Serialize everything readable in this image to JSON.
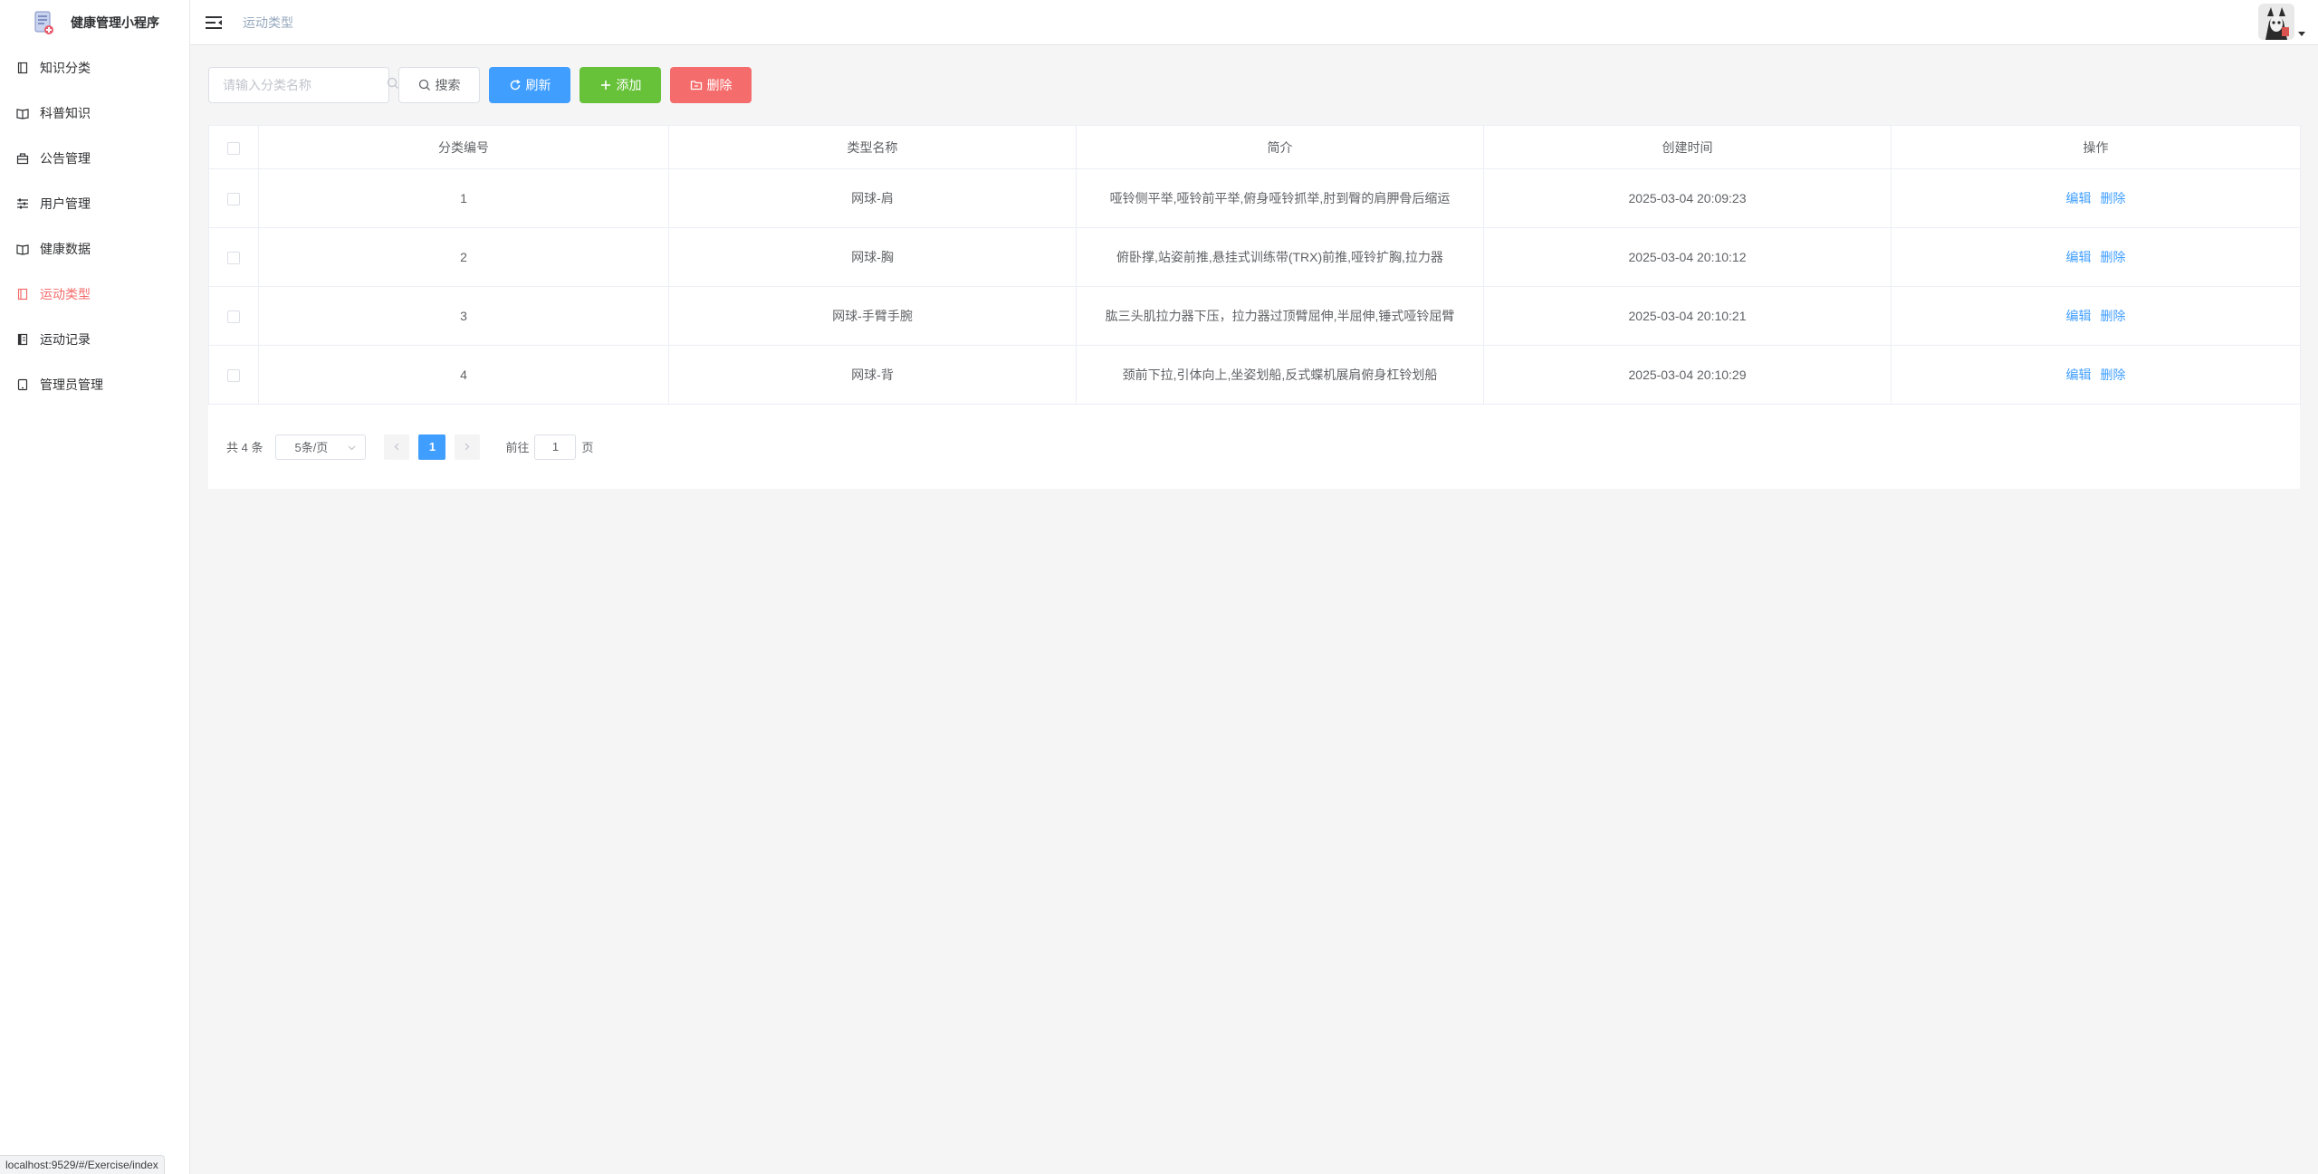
{
  "app": {
    "title": "健康管理小程序"
  },
  "sidebar": {
    "items": [
      {
        "label": "知识分类",
        "icon": "book-icon",
        "active": false
      },
      {
        "label": "科普知识",
        "icon": "open-book-icon",
        "active": false
      },
      {
        "label": "公告管理",
        "icon": "briefcase-icon",
        "active": false
      },
      {
        "label": "用户管理",
        "icon": "sliders-icon",
        "active": false
      },
      {
        "label": "健康数据",
        "icon": "open-book-icon",
        "active": false
      },
      {
        "label": "运动类型",
        "icon": "book-icon",
        "active": true
      },
      {
        "label": "运动记录",
        "icon": "notebook-icon",
        "active": false
      },
      {
        "label": "管理员管理",
        "icon": "tablet-icon",
        "active": false
      }
    ]
  },
  "header": {
    "breadcrumb": "运动类型"
  },
  "toolbar": {
    "search_placeholder": "请输入分类名称",
    "search_label": "搜索",
    "refresh_label": "刷新",
    "add_label": "添加",
    "delete_label": "删除"
  },
  "table": {
    "columns": [
      "分类编号",
      "类型名称",
      "简介",
      "创建时间",
      "操作"
    ],
    "rows": [
      {
        "id": "1",
        "name": "网球-肩",
        "desc": "哑铃侧平举,哑铃前平举,俯身哑铃抓举,肘到臀的肩胛骨后缩运",
        "created": "2025-03-04 20:09:23"
      },
      {
        "id": "2",
        "name": "网球-胸",
        "desc": "俯卧撑,站姿前推,悬挂式训练带(TRX)前推,哑铃扩胸,拉力器",
        "created": "2025-03-04 20:10:12"
      },
      {
        "id": "3",
        "name": "网球-手臂手腕",
        "desc": "肱三头肌拉力器下压，拉力器过顶臂屈伸,半屈伸,锤式哑铃屈臂",
        "created": "2025-03-04 20:10:21"
      },
      {
        "id": "4",
        "name": "网球-背",
        "desc": "颈前下拉,引体向上,坐姿划船,反式蝶机展肩俯身杠铃划船",
        "created": "2025-03-04 20:10:29"
      }
    ],
    "action_edit": "编辑",
    "action_delete": "删除"
  },
  "pagination": {
    "total_text": "共 4 条",
    "page_size": "5条/页",
    "current_page": "1",
    "goto_prefix": "前往",
    "goto_value": "1",
    "goto_suffix": "页"
  },
  "status_bar": {
    "url": "localhost:9529/#/Exercise/index"
  },
  "colors": {
    "primary": "#409eff",
    "success": "#67c23a",
    "danger": "#f56c6c",
    "active_menu": "#f56c6c"
  }
}
